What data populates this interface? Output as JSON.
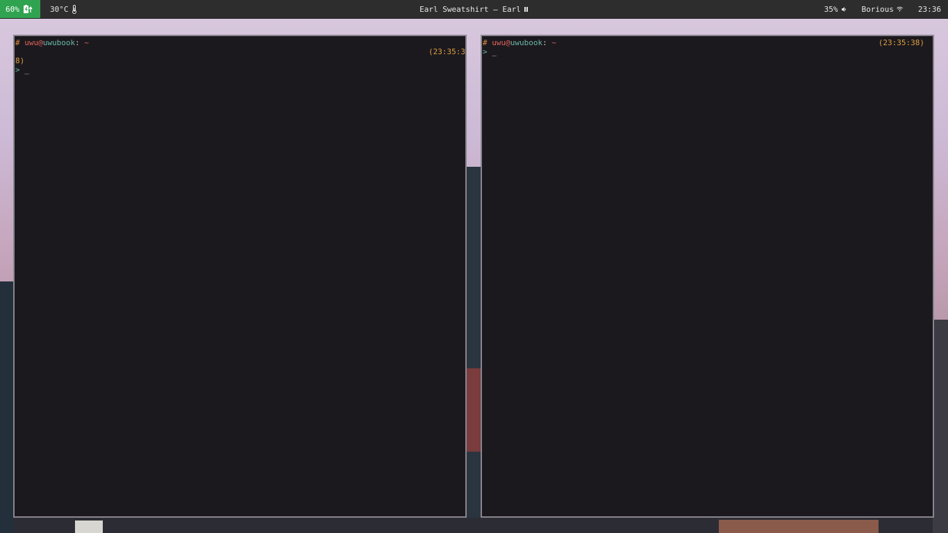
{
  "topbar": {
    "battery": "60%",
    "temperature": "30°C",
    "now_playing": "Earl Sweatshirt – Earl",
    "volume": "35%",
    "wifi": "Borious",
    "clock": "23:36"
  },
  "terminals": [
    {
      "prompt_hash": "#",
      "user": "uwu",
      "host": "uwubook",
      "path": "~",
      "timestamp_part1": "(23:35:3",
      "timestamp_part2": "8)",
      "arrow": ">",
      "cursor": "_"
    },
    {
      "prompt_hash": "#",
      "user": "uwu",
      "host": "uwubook",
      "path": "~",
      "timestamp": "(23:35:38)",
      "arrow": ">",
      "cursor": "_"
    }
  ],
  "colors": {
    "battery_bg": "#2fa34f",
    "terminal_bg": "#1b191e",
    "prompt_orange": "#e08a3c",
    "prompt_red": "#e2625a",
    "prompt_teal": "#6ab8a8",
    "timestamp": "#e0a040"
  }
}
